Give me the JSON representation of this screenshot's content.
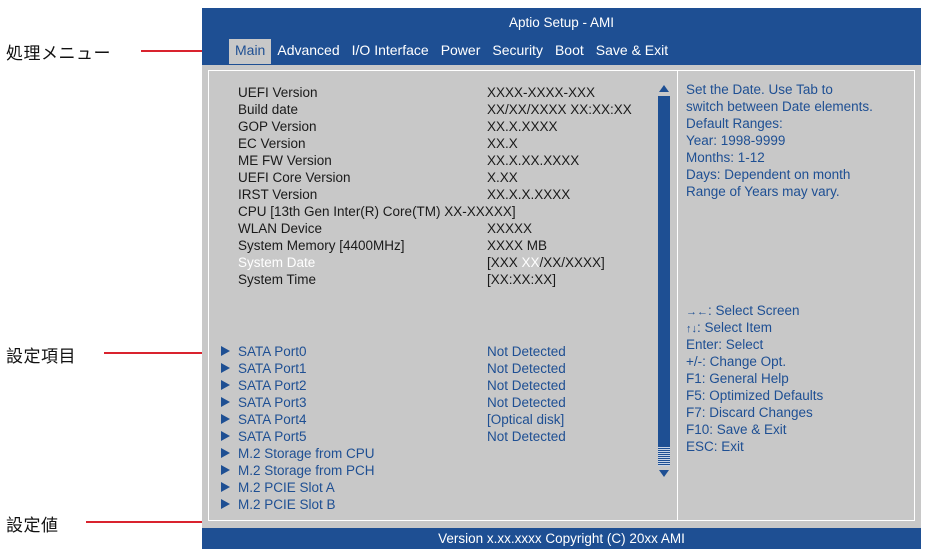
{
  "annotations": {
    "menu": "処理メニュー",
    "item": "設定項目",
    "value": "設定値"
  },
  "title": "Aptio Setup - AMI",
  "menu": [
    "Main",
    "Advanced",
    "I/O Interface",
    "Power",
    "Security",
    "Boot",
    "Save & Exit"
  ],
  "active_menu": "Main",
  "info": [
    {
      "label": "UEFI Version",
      "value": "XXXX-XXXX-XXX"
    },
    {
      "label": "Build date",
      "value": "XX/XX/XXXX XX:XX:XX"
    },
    {
      "label": "GOP Version",
      "value": "XX.X.XXXX"
    },
    {
      "label": "EC Version",
      "value": "XX.X"
    },
    {
      "label": "ME FW Version",
      "value": "XX.X.XX.XXXX"
    },
    {
      "label": "UEFI Core Version",
      "value": "X.XX"
    },
    {
      "label": "IRST Version",
      "value": "XX.X.X.XXXX"
    },
    {
      "label": "CPU [13th Gen Inter(R) Core(TM) XX-XXXXX]",
      "value": ""
    },
    {
      "label": "WLAN Device",
      "value": "XXXXX"
    },
    {
      "label": "System Memory [4400MHz]",
      "value": "XXXX MB"
    }
  ],
  "system_date": {
    "label": "System Date",
    "value_prefix": "[XXX ",
    "value_highlight": "XX",
    "value_suffix": "/XX/XXXX]"
  },
  "system_time": {
    "label": "System Time",
    "value": "[XX:XX:XX]"
  },
  "submenus": [
    {
      "label": "SATA Port0",
      "value": "Not Detected"
    },
    {
      "label": "SATA Port1",
      "value": "Not Detected"
    },
    {
      "label": "SATA Port2",
      "value": "Not Detected"
    },
    {
      "label": "SATA Port3",
      "value": "Not Detected"
    },
    {
      "label": "SATA Port4",
      "value": "[Optical disk]"
    },
    {
      "label": "SATA Port5",
      "value": "Not Detected"
    },
    {
      "label": "M.2 Storage from CPU",
      "value": ""
    },
    {
      "label": "M.2 Storage from PCH",
      "value": ""
    },
    {
      "label": "M.2 PCIE Slot A",
      "value": ""
    },
    {
      "label": "M.2 PCIE Slot B",
      "value": ""
    }
  ],
  "help_text": [
    "Set the Date. Use Tab to",
    "switch between Date elements.",
    "Default Ranges:",
    "Year: 1998-9999",
    "Months: 1-12",
    "Days: Dependent on month",
    "Range of Years may vary."
  ],
  "key_help": [
    {
      "glyph": "→←",
      "text": ": Select Screen"
    },
    {
      "glyph": "↑↓",
      "text": ": Select Item"
    },
    {
      "glyph": "",
      "text": "Enter: Select"
    },
    {
      "glyph": "",
      "text": "+/-: Change Opt."
    },
    {
      "glyph": "",
      "text": "F1: General Help"
    },
    {
      "glyph": "",
      "text": "F5: Optimized Defaults"
    },
    {
      "glyph": "",
      "text": "F7: Discard Changes"
    },
    {
      "glyph": "",
      "text": "F10: Save & Exit"
    },
    {
      "glyph": "",
      "text": "ESC: Exit"
    }
  ],
  "footer": "Version x.xx.xxxx Copyright (C) 20xx AMI",
  "colors": {
    "bios_blue": "#1e4f93",
    "panel_gray": "#c8c8c8",
    "callout_red": "#d9232e"
  }
}
